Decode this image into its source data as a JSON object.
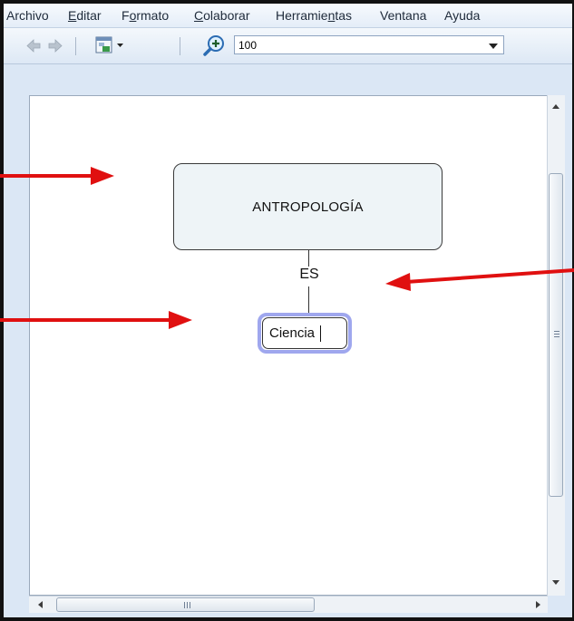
{
  "menubar": {
    "items": [
      {
        "label": "Archivo",
        "mnemonic_index": -1
      },
      {
        "label": "Editar",
        "mnemonic_index": 0
      },
      {
        "label": "Formato",
        "mnemonic_index": 1
      },
      {
        "label": "Colaborar",
        "mnemonic_index": 0
      },
      {
        "label": "Herramientas",
        "mnemonic_index": 8
      },
      {
        "label": "Ventana",
        "mnemonic_index": -1
      },
      {
        "label": "Ayuda",
        "mnemonic_index": -1
      }
    ]
  },
  "toolbar": {
    "back_icon": "back-arrow-icon",
    "forward_icon": "forward-arrow-icon",
    "view_icon": "window-view-icon",
    "zoom_icon": "zoom-in-icon",
    "zoom_value": "100"
  },
  "map": {
    "main_concept": "ANTROPOLOGÍA",
    "link_phrase": "ES",
    "child_concept": "Ciencia"
  },
  "colors": {
    "annotation_arrow": "#e01010",
    "selection_halo": "#9fa7ee",
    "concept_fill": "#eef4f7"
  }
}
